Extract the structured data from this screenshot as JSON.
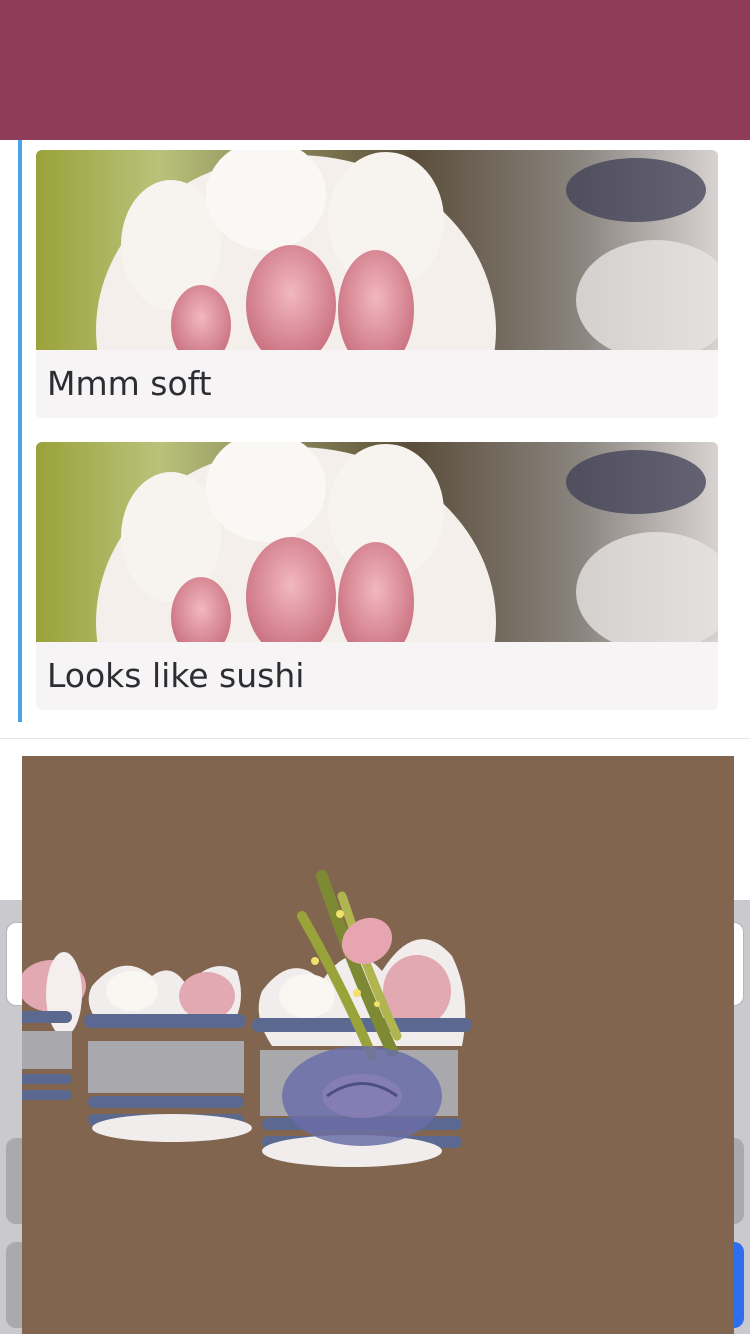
{
  "app": {
    "header_color": "#8f3c59",
    "thread_bar_color": "#4aa3ef"
  },
  "messages": [
    {
      "image_icon": "cat-paw-photo",
      "caption": "Mmm soft"
    },
    {
      "image_icon": "cat-paw-photo",
      "caption": "Looks like sushi"
    }
  ],
  "sticker": {
    "icon": "sushi-cat-paws-sticker",
    "background_color": "#81654f"
  },
  "composer": {
    "input_value": "",
    "primary_button_color": "#2d6ef0"
  }
}
